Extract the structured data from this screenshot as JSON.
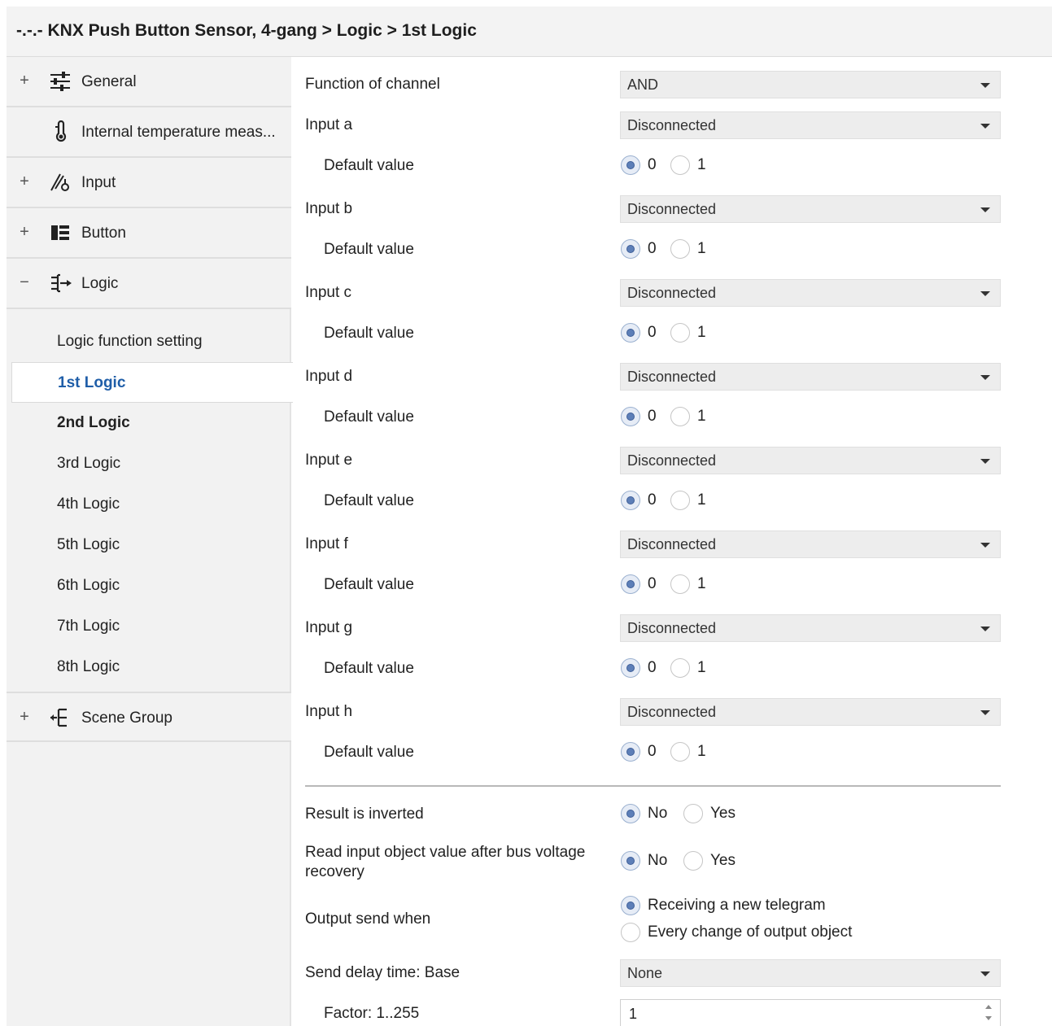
{
  "title": "-.-.- KNX Push Button Sensor, 4-gang > Logic > 1st Logic",
  "sidebar": {
    "nav": [
      {
        "expander": "+",
        "icon": "sliders-icon",
        "label": "General"
      },
      {
        "expander": "",
        "icon": "thermometer-icon",
        "label": "Internal temperature meas..."
      },
      {
        "expander": "+",
        "icon": "input-switch-icon",
        "label": "Input"
      },
      {
        "expander": "+",
        "icon": "button-panel-icon",
        "label": "Button"
      },
      {
        "expander": "−",
        "icon": "logic-gate-icon",
        "label": "Logic"
      }
    ],
    "logic_items": [
      "Logic function setting",
      "1st Logic",
      "2nd Logic",
      "3rd Logic",
      "4th Logic",
      "5th Logic",
      "6th Logic",
      "7th Logic",
      "8th Logic"
    ],
    "active_item": "1st Logic",
    "scene": {
      "expander": "+",
      "icon": "scene-group-icon",
      "label": "Scene Group"
    }
  },
  "form": {
    "function": {
      "label": "Function of channel",
      "value": "AND"
    },
    "inputs": [
      {
        "label": "Input a",
        "value": "Disconnected",
        "default_label": "Default value",
        "selected": "0"
      },
      {
        "label": "Input b",
        "value": "Disconnected",
        "default_label": "Default value",
        "selected": "0"
      },
      {
        "label": "Input c",
        "value": "Disconnected",
        "default_label": "Default value",
        "selected": "0"
      },
      {
        "label": "Input d",
        "value": "Disconnected",
        "default_label": "Default value",
        "selected": "0"
      },
      {
        "label": "Input e",
        "value": "Disconnected",
        "default_label": "Default value",
        "selected": "0"
      },
      {
        "label": "Input f",
        "value": "Disconnected",
        "default_label": "Default value",
        "selected": "0"
      },
      {
        "label": "Input g",
        "value": "Disconnected",
        "default_label": "Default value",
        "selected": "0"
      },
      {
        "label": "Input h",
        "value": "Disconnected",
        "default_label": "Default value",
        "selected": "0"
      }
    ],
    "radio_01": [
      "0",
      "1"
    ],
    "result_inverted": {
      "label": "Result is inverted",
      "options": [
        "No",
        "Yes"
      ],
      "selected": "No"
    },
    "read_input": {
      "label": "Read input object value after bus voltage recovery",
      "options": [
        "No",
        "Yes"
      ],
      "selected": "No"
    },
    "output_send": {
      "label": "Output send when",
      "options": [
        "Receiving a new telegram",
        "Every change of output object"
      ],
      "selected": "Receiving a new telegram"
    },
    "send_delay_base": {
      "label": "Send delay time: Base",
      "value": "None"
    },
    "factor": {
      "label": "Factor: 1..255",
      "value": "1"
    }
  }
}
